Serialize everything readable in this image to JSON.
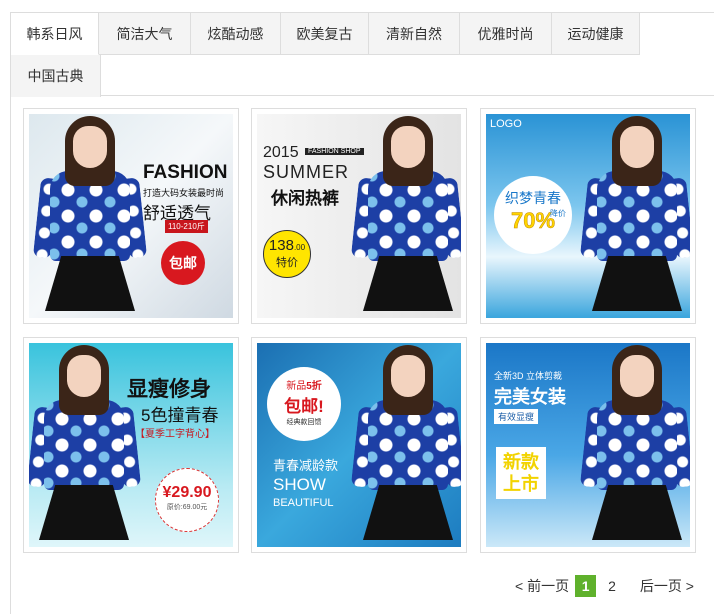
{
  "tabs": [
    {
      "label": "韩系日风"
    },
    {
      "label": "简洁大气"
    },
    {
      "label": "炫酷动感"
    },
    {
      "label": "欧美复古"
    },
    {
      "label": "清新自然"
    },
    {
      "label": "优雅时尚"
    },
    {
      "label": "运动健康"
    },
    {
      "label": "中国古典"
    }
  ],
  "cards": [
    {
      "headline": "FASHION",
      "sub": "打造大码女装最时尚",
      "big": "舒适透气",
      "tag": "110-210斤",
      "badge": "包邮"
    },
    {
      "year": "2015",
      "shop": "FASHION SHOP",
      "summer": "SUMMER",
      "big": "休闲热裤",
      "price": "138",
      "price_dec": ".00",
      "price_label": "特价"
    },
    {
      "logo": "LOGO",
      "big": "织梦青春",
      "pct": "70%",
      "discount": "降价"
    },
    {
      "big": "显瘦修身",
      "sub": "5色撞青春",
      "season": "【夏季工字背心】",
      "price": "¥29.90",
      "orig": "原价:69.00元"
    },
    {
      "new": "新品",
      "off": "5折",
      "free": "包邮!",
      "tag": "经典款回馈",
      "cn": "青春减龄款",
      "show": "SHOW",
      "beautiful": "BEAUTIFUL"
    },
    {
      "top": "全新3D 立体剪裁",
      "big": "完美女装",
      "tag": "有效显瘦",
      "new": "新款",
      "launch": "上市"
    }
  ],
  "pager": {
    "prev": "< 前一页",
    "page1": "1",
    "page2": "2",
    "next": "后一页 >"
  }
}
